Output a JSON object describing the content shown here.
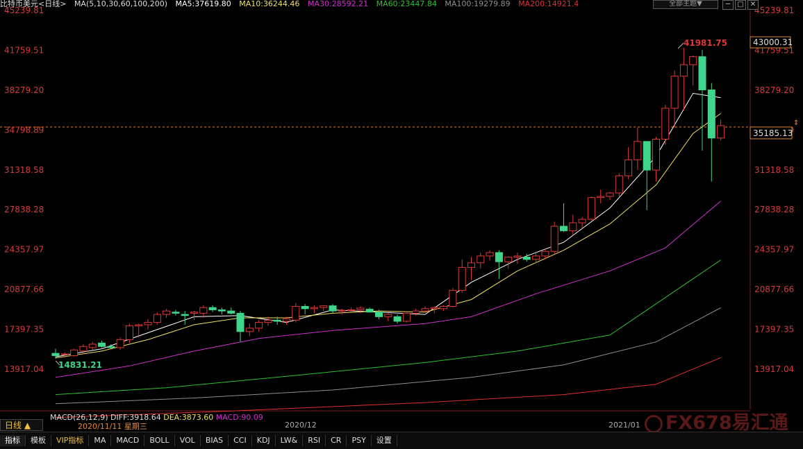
{
  "header": {
    "title": "比特币美元<日线>",
    "ma_config": "MA(5,10,30,60,100,200)",
    "ma5": "MA5:37619.80",
    "ma10": "MA10:36244.46",
    "ma30": "MA30:28592.21",
    "ma60": "MA60:23447.84",
    "ma100": "MA100:19279.89",
    "ma200": "MA200:14921.4",
    "theme_button": "全部主题▼"
  },
  "window_buttons": [
    "─",
    "▢",
    "✕"
  ],
  "price_axis": {
    "labels": [
      "45239.81",
      "41759.51",
      "38279.20",
      "34798.89",
      "31318.58",
      "27838.28",
      "24357.97",
      "20877.66",
      "17397.35",
      "13917.04"
    ],
    "current_price": "35185.13",
    "hover_price": "43000.31"
  },
  "annotations": {
    "high": "41981.75",
    "low": "14831.21"
  },
  "macd": {
    "label": "MACD(26,12,9)",
    "diff": "DIFF:3918.64",
    "dea": "DEA:3873.60",
    "macd": "MACD:90.09"
  },
  "date_axis": {
    "period_badge": "日线 ▲",
    "cursor_date": "2020/11/11 星期三",
    "month1": "2020/12",
    "month2": "2021/01"
  },
  "bottom_tabs": [
    "指标",
    "模板",
    "VIP指标",
    "MA",
    "MACD",
    "BOLL",
    "VOL",
    "BIAS",
    "CCI",
    "KDJ",
    "LW&",
    "RSI",
    "CR",
    "PSY",
    "设置"
  ],
  "watermark": "FX678易汇通",
  "colors": {
    "up": "#e03838",
    "down": "#3ed68a",
    "ma5": "#ffffff",
    "ma10": "#f0e060",
    "ma30": "#d030d0",
    "ma60": "#30c030",
    "ma100": "#909090",
    "ma200": "#e03030"
  },
  "chart_data": {
    "type": "candlestick",
    "ylim": [
      13917.04,
      45239.81
    ],
    "candles": [
      {
        "o": 15300,
        "h": 15700,
        "l": 14831,
        "c": 15100
      },
      {
        "o": 15200,
        "h": 15400,
        "l": 14900,
        "c": 15250
      },
      {
        "o": 15100,
        "h": 15700,
        "l": 15000,
        "c": 15600
      },
      {
        "o": 15500,
        "h": 16100,
        "l": 15300,
        "c": 15900
      },
      {
        "o": 15800,
        "h": 16300,
        "l": 15600,
        "c": 16100
      },
      {
        "o": 16200,
        "h": 16400,
        "l": 15800,
        "c": 15900
      },
      {
        "o": 15900,
        "h": 16100,
        "l": 15700,
        "c": 15800
      },
      {
        "o": 15800,
        "h": 16700,
        "l": 15600,
        "c": 16500
      },
      {
        "o": 16500,
        "h": 17900,
        "l": 16200,
        "c": 17700
      },
      {
        "o": 17700,
        "h": 17900,
        "l": 16700,
        "c": 17800
      },
      {
        "o": 17800,
        "h": 18300,
        "l": 17400,
        "c": 18000
      },
      {
        "o": 18000,
        "h": 18900,
        "l": 17800,
        "c": 18700
      },
      {
        "o": 18700,
        "h": 19200,
        "l": 18400,
        "c": 19000
      },
      {
        "o": 18900,
        "h": 19100,
        "l": 18600,
        "c": 18800
      },
      {
        "o": 18700,
        "h": 19000,
        "l": 17800,
        "c": 18600
      },
      {
        "o": 18800,
        "h": 19000,
        "l": 18200,
        "c": 18900
      },
      {
        "o": 18800,
        "h": 19500,
        "l": 18400,
        "c": 19300
      },
      {
        "o": 19300,
        "h": 19500,
        "l": 18900,
        "c": 19100
      },
      {
        "o": 19100,
        "h": 19300,
        "l": 18700,
        "c": 19000
      },
      {
        "o": 19000,
        "h": 19300,
        "l": 18700,
        "c": 18800
      },
      {
        "o": 18800,
        "h": 19000,
        "l": 16300,
        "c": 17200
      },
      {
        "o": 17200,
        "h": 17900,
        "l": 16800,
        "c": 17500
      },
      {
        "o": 17500,
        "h": 18200,
        "l": 17200,
        "c": 18000
      },
      {
        "o": 18000,
        "h": 18500,
        "l": 17700,
        "c": 18200
      },
      {
        "o": 18200,
        "h": 18500,
        "l": 17800,
        "c": 18100
      },
      {
        "o": 18100,
        "h": 18500,
        "l": 17800,
        "c": 18300
      },
      {
        "o": 18200,
        "h": 19700,
        "l": 18000,
        "c": 19400
      },
      {
        "o": 19400,
        "h": 19600,
        "l": 18700,
        "c": 19200
      },
      {
        "o": 19200,
        "h": 19500,
        "l": 18800,
        "c": 19300
      },
      {
        "o": 19300,
        "h": 19500,
        "l": 19000,
        "c": 19450
      },
      {
        "o": 19450,
        "h": 19600,
        "l": 18800,
        "c": 19000
      },
      {
        "o": 19000,
        "h": 19200,
        "l": 18700,
        "c": 19050
      },
      {
        "o": 19050,
        "h": 19300,
        "l": 18900,
        "c": 19100
      },
      {
        "o": 19100,
        "h": 19400,
        "l": 18800,
        "c": 19250
      },
      {
        "o": 19150,
        "h": 19300,
        "l": 18900,
        "c": 18900
      },
      {
        "o": 18900,
        "h": 19100,
        "l": 18300,
        "c": 18500
      },
      {
        "o": 18500,
        "h": 18800,
        "l": 18100,
        "c": 18700
      },
      {
        "o": 18500,
        "h": 18700,
        "l": 17900,
        "c": 18100
      },
      {
        "o": 18100,
        "h": 19000,
        "l": 18000,
        "c": 18800
      },
      {
        "o": 18800,
        "h": 19200,
        "l": 18600,
        "c": 19000
      },
      {
        "o": 19000,
        "h": 19400,
        "l": 18900,
        "c": 19200
      },
      {
        "o": 19200,
        "h": 19400,
        "l": 18800,
        "c": 19300
      },
      {
        "o": 19200,
        "h": 19500,
        "l": 19000,
        "c": 19400
      },
      {
        "o": 19400,
        "h": 21000,
        "l": 19300,
        "c": 20800
      },
      {
        "o": 20800,
        "h": 23500,
        "l": 20600,
        "c": 22800
      },
      {
        "o": 22800,
        "h": 23700,
        "l": 21700,
        "c": 23200
      },
      {
        "o": 23200,
        "h": 24100,
        "l": 22700,
        "c": 23800
      },
      {
        "o": 23800,
        "h": 24300,
        "l": 23400,
        "c": 24100
      },
      {
        "o": 24100,
        "h": 24300,
        "l": 21800,
        "c": 23300
      },
      {
        "o": 23300,
        "h": 23800,
        "l": 22700,
        "c": 23700
      },
      {
        "o": 23700,
        "h": 24100,
        "l": 23100,
        "c": 23800
      },
      {
        "o": 23700,
        "h": 24000,
        "l": 23300,
        "c": 23500
      },
      {
        "o": 23500,
        "h": 24200,
        "l": 23200,
        "c": 23800
      },
      {
        "o": 23800,
        "h": 24400,
        "l": 23500,
        "c": 24200
      },
      {
        "o": 24200,
        "h": 26800,
        "l": 24000,
        "c": 26400
      },
      {
        "o": 26400,
        "h": 28400,
        "l": 25900,
        "c": 26000
      },
      {
        "o": 26000,
        "h": 27400,
        "l": 25600,
        "c": 26700
      },
      {
        "o": 26700,
        "h": 27200,
        "l": 26200,
        "c": 27000
      },
      {
        "o": 27000,
        "h": 29000,
        "l": 26900,
        "c": 28900
      },
      {
        "o": 28900,
        "h": 29600,
        "l": 28400,
        "c": 29000
      },
      {
        "o": 29000,
        "h": 29400,
        "l": 28700,
        "c": 29300
      },
      {
        "o": 29300,
        "h": 31000,
        "l": 29000,
        "c": 30800
      },
      {
        "o": 30800,
        "h": 33300,
        "l": 30500,
        "c": 32200
      },
      {
        "o": 32200,
        "h": 35000,
        "l": 31300,
        "c": 33800
      },
      {
        "o": 33800,
        "h": 33800,
        "l": 27800,
        "c": 31300
      },
      {
        "o": 31300,
        "h": 34200,
        "l": 30300,
        "c": 34000
      },
      {
        "o": 34000,
        "h": 37000,
        "l": 33500,
        "c": 36700
      },
      {
        "o": 36700,
        "h": 40000,
        "l": 35000,
        "c": 39500
      },
      {
        "o": 39500,
        "h": 41981,
        "l": 36500,
        "c": 40500
      },
      {
        "o": 40500,
        "h": 41300,
        "l": 38700,
        "c": 41200
      },
      {
        "o": 41200,
        "h": 41800,
        "l": 33000,
        "c": 38300
      },
      {
        "o": 38300,
        "h": 38900,
        "l": 30300,
        "c": 34100
      },
      {
        "o": 34100,
        "h": 35700,
        "l": 33900,
        "c": 35185
      }
    ],
    "moving_averages": [
      {
        "name": "MA5",
        "values": [
          [
            0,
            15000
          ],
          [
            5,
            15700
          ],
          [
            10,
            17100
          ],
          [
            15,
            18500
          ],
          [
            20,
            18600
          ],
          [
            25,
            18000
          ],
          [
            30,
            19100
          ],
          [
            35,
            18900
          ],
          [
            40,
            18700
          ],
          [
            45,
            21500
          ],
          [
            50,
            23500
          ],
          [
            55,
            25000
          ],
          [
            60,
            28000
          ],
          [
            65,
            32500
          ],
          [
            69,
            38000
          ],
          [
            72,
            37620
          ]
        ]
      },
      {
        "name": "MA10",
        "values": [
          [
            0,
            14900
          ],
          [
            5,
            15500
          ],
          [
            10,
            16500
          ],
          [
            15,
            17800
          ],
          [
            20,
            18400
          ],
          [
            25,
            18400
          ],
          [
            30,
            18800
          ],
          [
            35,
            19000
          ],
          [
            40,
            18900
          ],
          [
            45,
            20000
          ],
          [
            50,
            22500
          ],
          [
            55,
            24300
          ],
          [
            60,
            26600
          ],
          [
            65,
            30000
          ],
          [
            69,
            34500
          ],
          [
            72,
            36244
          ]
        ]
      },
      {
        "name": "MA30",
        "values": [
          [
            0,
            13200
          ],
          [
            8,
            14200
          ],
          [
            15,
            15500
          ],
          [
            22,
            16600
          ],
          [
            30,
            17300
          ],
          [
            40,
            17900
          ],
          [
            45,
            18500
          ],
          [
            52,
            20500
          ],
          [
            60,
            22500
          ],
          [
            66,
            24500
          ],
          [
            72,
            28592
          ]
        ]
      },
      {
        "name": "MA60",
        "values": [
          [
            0,
            11700
          ],
          [
            12,
            12300
          ],
          [
            25,
            13300
          ],
          [
            40,
            14500
          ],
          [
            50,
            15500
          ],
          [
            60,
            16900
          ],
          [
            72,
            23448
          ]
        ]
      },
      {
        "name": "MA100",
        "values": [
          [
            0,
            10900
          ],
          [
            15,
            11400
          ],
          [
            30,
            12100
          ],
          [
            45,
            13200
          ],
          [
            55,
            14300
          ],
          [
            65,
            16300
          ],
          [
            72,
            19280
          ]
        ]
      },
      {
        "name": "MA200",
        "values": [
          [
            0,
            9700
          ],
          [
            20,
            10300
          ],
          [
            40,
            11000
          ],
          [
            55,
            11700
          ],
          [
            65,
            12600
          ],
          [
            72,
            14921
          ]
        ]
      }
    ]
  }
}
